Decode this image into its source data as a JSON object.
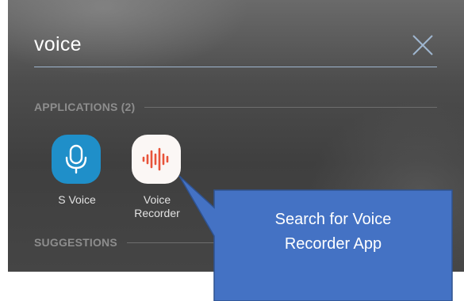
{
  "search": {
    "query": "voice"
  },
  "sections": {
    "applications_title": "APPLICATIONS (2)",
    "suggestions_title": "SUGGESTIONS"
  },
  "apps": [
    {
      "label_line1": "S Voice",
      "icon": "microphone-icon"
    },
    {
      "label_line1": "Voice",
      "label_line2": "Recorder",
      "icon": "waveform-icon"
    }
  ],
  "callout": {
    "line1": "Search for Voice",
    "line2": "Recorder App"
  },
  "colors": {
    "accent_blue": "#4472c4",
    "svoice_icon_bg": "#1f8fc9",
    "recorder_wave": "#e8533a"
  }
}
